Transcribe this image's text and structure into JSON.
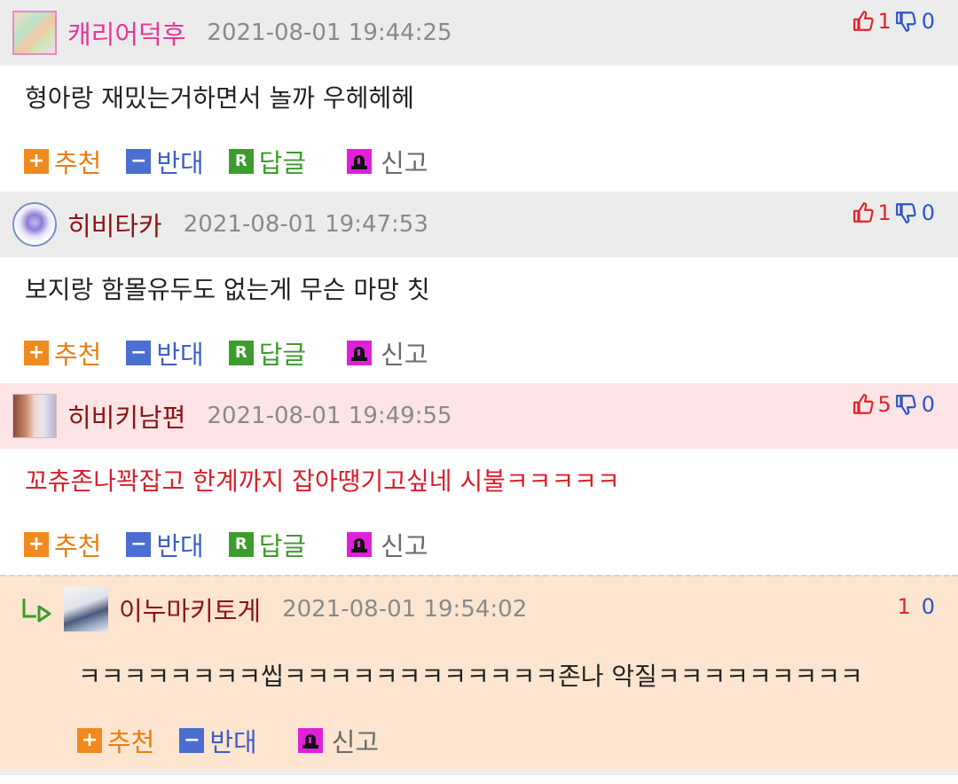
{
  "comments": [
    {
      "nick": "캐리어덕후",
      "nick_color": "#e8379a",
      "time": "2021-08-01 19:44:25",
      "up": "1",
      "down": "0",
      "text": "형아랑 재밌는거하면서 놀까 우헤헤헤",
      "text_red": false
    },
    {
      "nick": "히비타카",
      "nick_color": "#8b1414",
      "time": "2021-08-01 19:47:53",
      "up": "1",
      "down": "0",
      "text": "보지랑 함몰유두도 없는게 무슨 마망 칫",
      "text_red": false
    },
    {
      "nick": "히비키남편",
      "nick_color": "#8b1414",
      "time": "2021-08-01 19:49:55",
      "up": "5",
      "down": "0",
      "text": "꼬츄존나꽉잡고 한계까지 잡아땡기고싶네 시불ㅋㅋㅋㅋㅋ",
      "text_red": true
    }
  ],
  "reply": {
    "nick": "이누마키토게",
    "nick_color": "#8b1414",
    "time": "2021-08-01 19:54:02",
    "up": "1",
    "down": "0",
    "text": "ㅋㅋㅋㅋㅋㅋㅋㅋ씹ㅋㅋㅋㅋㅋㅋㅋㅋㅋㅋㅋㅋ존나 악질ㅋㅋㅋㅋㅋㅋㅋㅋㅋ"
  },
  "actions": {
    "recommend": "추천",
    "oppose": "반대",
    "reply": "답글",
    "report": "신고",
    "reply_icon_letter": "R"
  },
  "icons": {
    "thumbs_up": "thumbs-up-icon",
    "thumbs_down": "thumbs-down-icon",
    "reply_arrow": "reply-arrow-icon"
  },
  "colors": {
    "upvote": "#e0242a",
    "downvote": "#2b55c7"
  }
}
